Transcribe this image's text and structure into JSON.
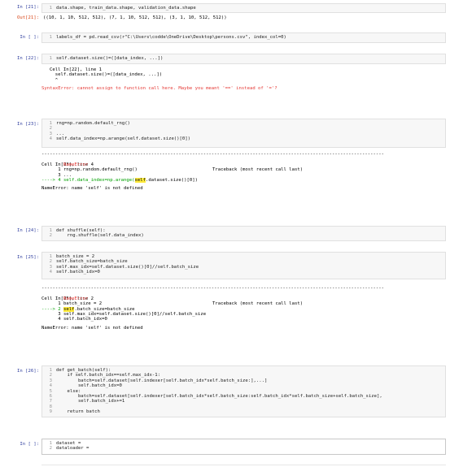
{
  "cells": {
    "c21": {
      "prompt_in": "In [21]:",
      "line1": "data.shape, train_data.shape, validation_data.shape",
      "prompt_out": "Out[21]:",
      "output": "((10, 1, 10, 512, 512), (7, 1, 10, 512, 512), (3, 1, 10, 512, 512))"
    },
    "c_blank1": {
      "prompt_in": "In [ ]:",
      "line1": "labels_df = pd.read_csv(r\"C:\\Users\\codde\\OneDrive\\Desktop\\persons.csv\", index_col=0)"
    },
    "c22": {
      "prompt_in": "In [22]:",
      "line1": "self.dataset.size()=([data_index, ...])",
      "err1": "Cell In[22], line 1",
      "err2": "  self.dataset.size()=([data_index, ...])",
      "err3": "  ^",
      "err4": "SyntaxError: cannot assign to function call here. Maybe you meant '==' instead of '='?"
    },
    "c23": {
      "prompt_in": "In [23]:",
      "line1": "rng=np.random.default_rng()",
      "line2": "",
      "line3": "...",
      "line4": "self.data_index=np.arange(self.dataset.size()[0])",
      "tb_name": "NameError",
      "tb_head": "Traceback (most recent call last)",
      "tb_cell": "Cell In[23], line 4",
      "tb1": "      1 rng=np.random.default_rng()",
      "tb2": "      3 ...",
      "tb3_pre": "----> 4 self.data_index=np.arange(",
      "tb3_hl": "self",
      "tb3_post": ".dataset.size()[0])",
      "tb_msg": "NameError: name 'self' is not defined"
    },
    "c24": {
      "prompt_in": "In [24]:",
      "line1": "def shuffle(self):",
      "line2": "    rng.shuffle(self.data_index)"
    },
    "c25": {
      "prompt_in": "In [25]:",
      "line1": "batch_size = 2",
      "line2": "self.batch_size=batch_size",
      "line3": "self.max_idx=self.dataset.size()[0]//self.batch_size",
      "line4": "self.batch_idx=0",
      "tb_name": "NameError",
      "tb_head": "Traceback (most recent call last)",
      "tb_cell": "Cell In[25], line 2",
      "tb1": "      1 batch_size = 2",
      "tb2_pre": "----> 2 ",
      "tb2_hl": "self",
      "tb2_post": ".batch_size=batch_size",
      "tb3": "      3 self.max_idx=self.dataset.size()[0]//self.batch_size",
      "tb4": "      4 self.batch_idx=0",
      "tb_msg": "NameError: name 'self' is not defined"
    },
    "c26": {
      "prompt_in": "In [26]:",
      "line1": "def get_batch(self):",
      "line2": "    if self.batch_idx==self.max_idx-1:",
      "line3": "        batch=self.dataset[self.indexer[self.batch_idx*self.batch_size:],...]",
      "line4": "        self.batch_idx=0",
      "line5": "    else:",
      "line6": "        batch=self.dataset[self.indexer[self.batch_idx*self.batch_size:self.batch_idx*self.batch_size+self.batch_size],",
      "line7": "        self.batch_idx+=1",
      "line8": "",
      "line9": "    return batch"
    },
    "c_blank2": {
      "prompt_in": "In [ ]:",
      "line1": "dataset = ",
      "line2": "dataloader = "
    }
  }
}
